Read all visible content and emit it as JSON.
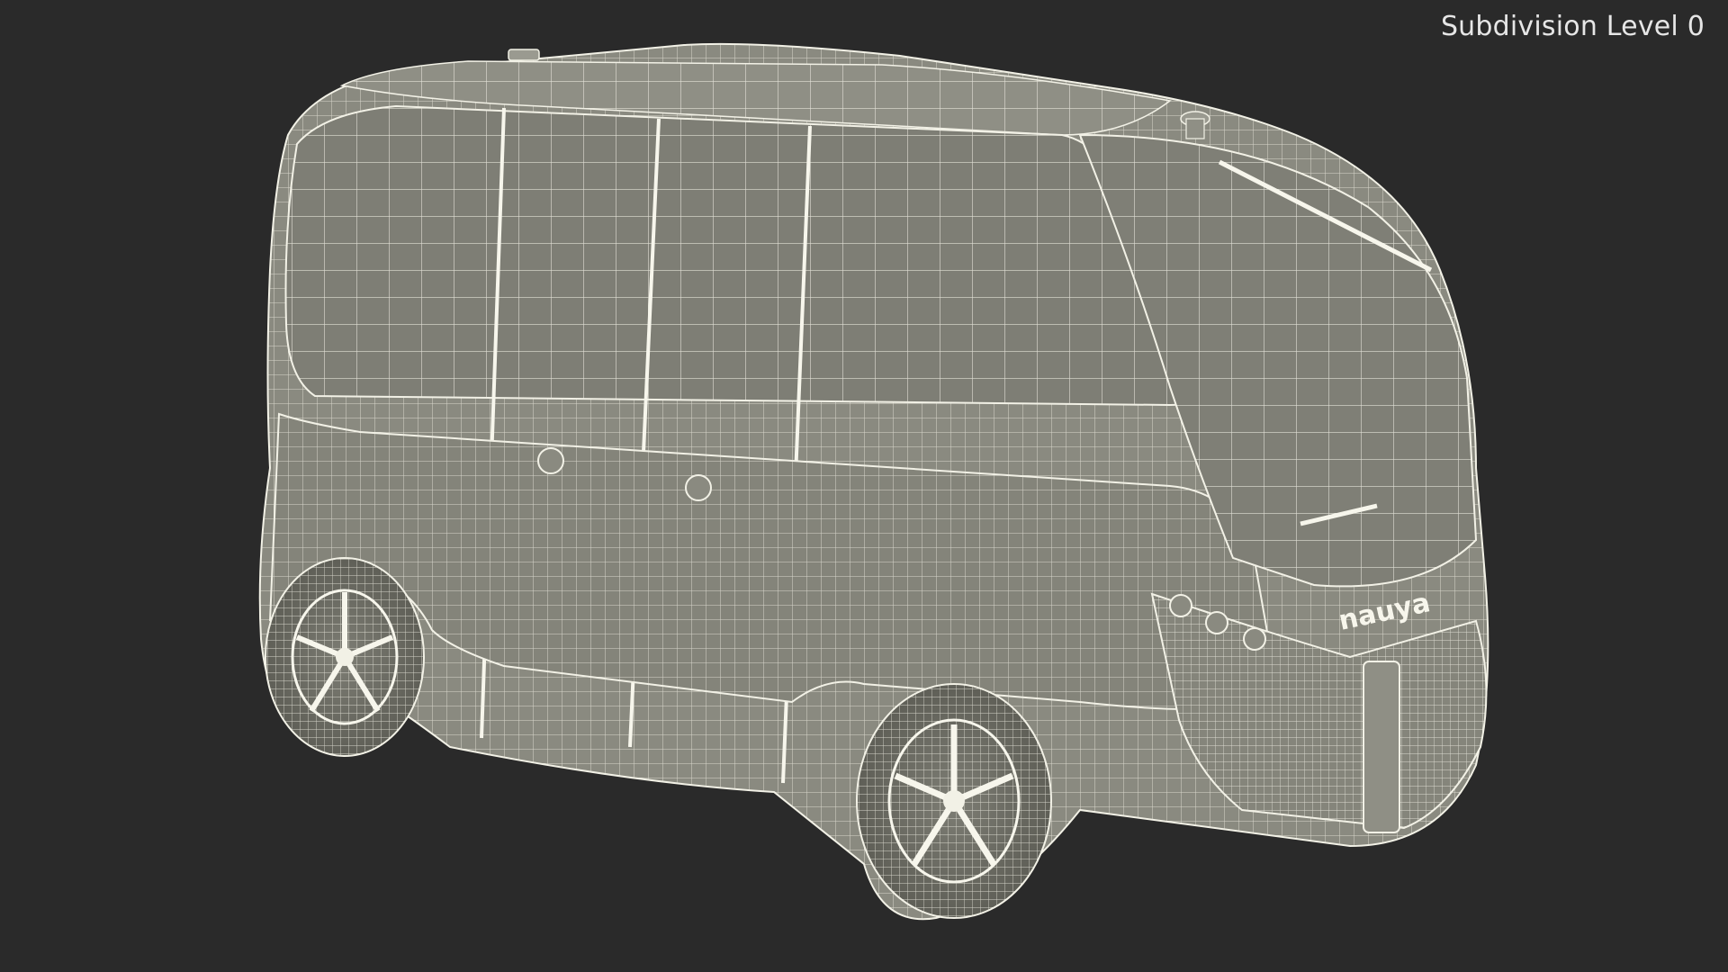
{
  "overlay": {
    "subdivision_label": "Subdivision Level 0"
  },
  "vehicle": {
    "brand_text": "nauya"
  },
  "colors": {
    "background": "#2a2a2a",
    "surface": "#8a8a80",
    "surface_dark": "#6f6f66",
    "wire": "#f2f1e6"
  }
}
